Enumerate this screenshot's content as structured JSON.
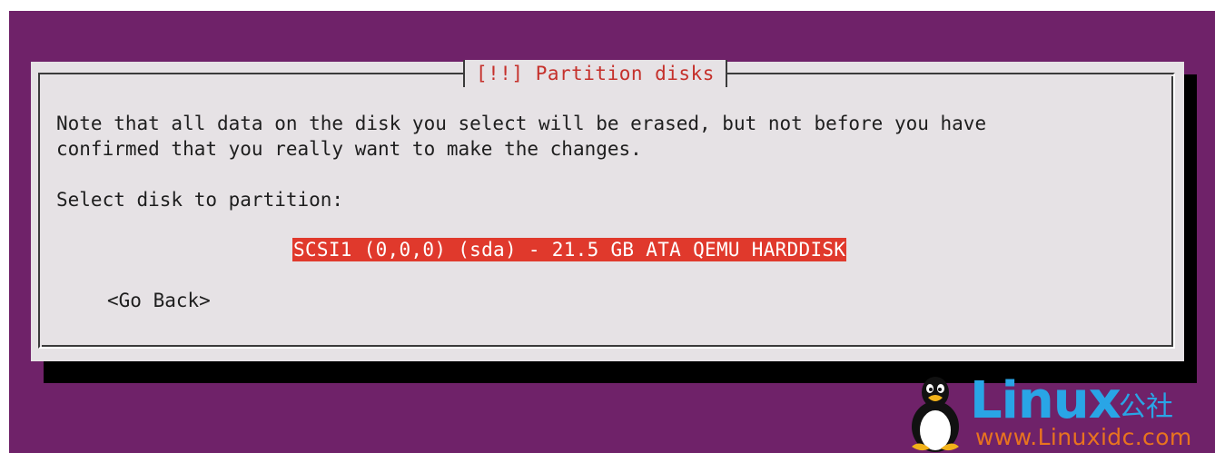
{
  "dialog": {
    "title": "[!!] Partition disks",
    "note_line1": "Note that all data on the disk you select will be erased, but not before you have",
    "note_line2": "confirmed that you really want to make the changes.",
    "select_label": "Select disk to partition:",
    "disk_options": [
      {
        "label": "SCSI1 (0,0,0) (sda) - 21.5 GB ATA QEMU HARDDISK",
        "selected": true
      }
    ],
    "go_back_label": "<Go Back>"
  },
  "watermark": {
    "brand": "Linux",
    "brand_cn": "公社",
    "url": "www.Linuxidc.com",
    "icon": "tux-penguin-icon"
  },
  "colors": {
    "background": "#6f2269",
    "dialog": "#e6e2e5",
    "title": "#c5302b",
    "selection": "#e0392c"
  }
}
